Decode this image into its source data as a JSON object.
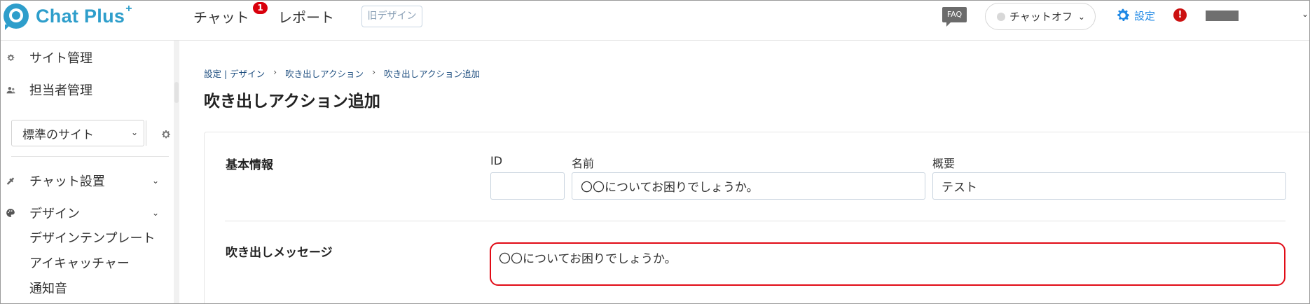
{
  "header": {
    "logo_text": "Chat Plus",
    "logo_plus": "+",
    "nav": {
      "chat": "チャット",
      "chat_badge": "1",
      "report": "レポート",
      "old_design": "旧デザイン"
    },
    "faq": "FAQ",
    "chat_status": "チャットオフ",
    "settings": "設定",
    "alert": "!"
  },
  "sidebar": {
    "site_admin": "サイト管理",
    "staff_admin": "担当者管理",
    "site_select": "標準のサイト",
    "chat_settings": "チャット設置",
    "design": "デザイン",
    "design_sub": [
      "デザインテンプレート",
      "アイキャッチャー",
      "通知音"
    ]
  },
  "main": {
    "breadcrumb": [
      "設定 | デザイン",
      "吹き出しアクション",
      "吹き出しアクション追加"
    ],
    "breadcrumb_sep": "›",
    "title": "吹き出しアクション追加",
    "basic_info": {
      "title": "基本情報",
      "id_label": "ID",
      "id_value": "",
      "name_label": "名前",
      "name_value": "〇〇についてお困りでしょうか。",
      "summary_label": "概要",
      "summary_value": "テスト"
    },
    "message": {
      "title": "吹き出しメッセージ",
      "value": "〇〇についてお困りでしょうか。"
    }
  },
  "colors": {
    "brand": "#2e9ecb",
    "link": "#1e88e5",
    "badge": "#d9000c",
    "highlight_border": "#e10b16"
  }
}
